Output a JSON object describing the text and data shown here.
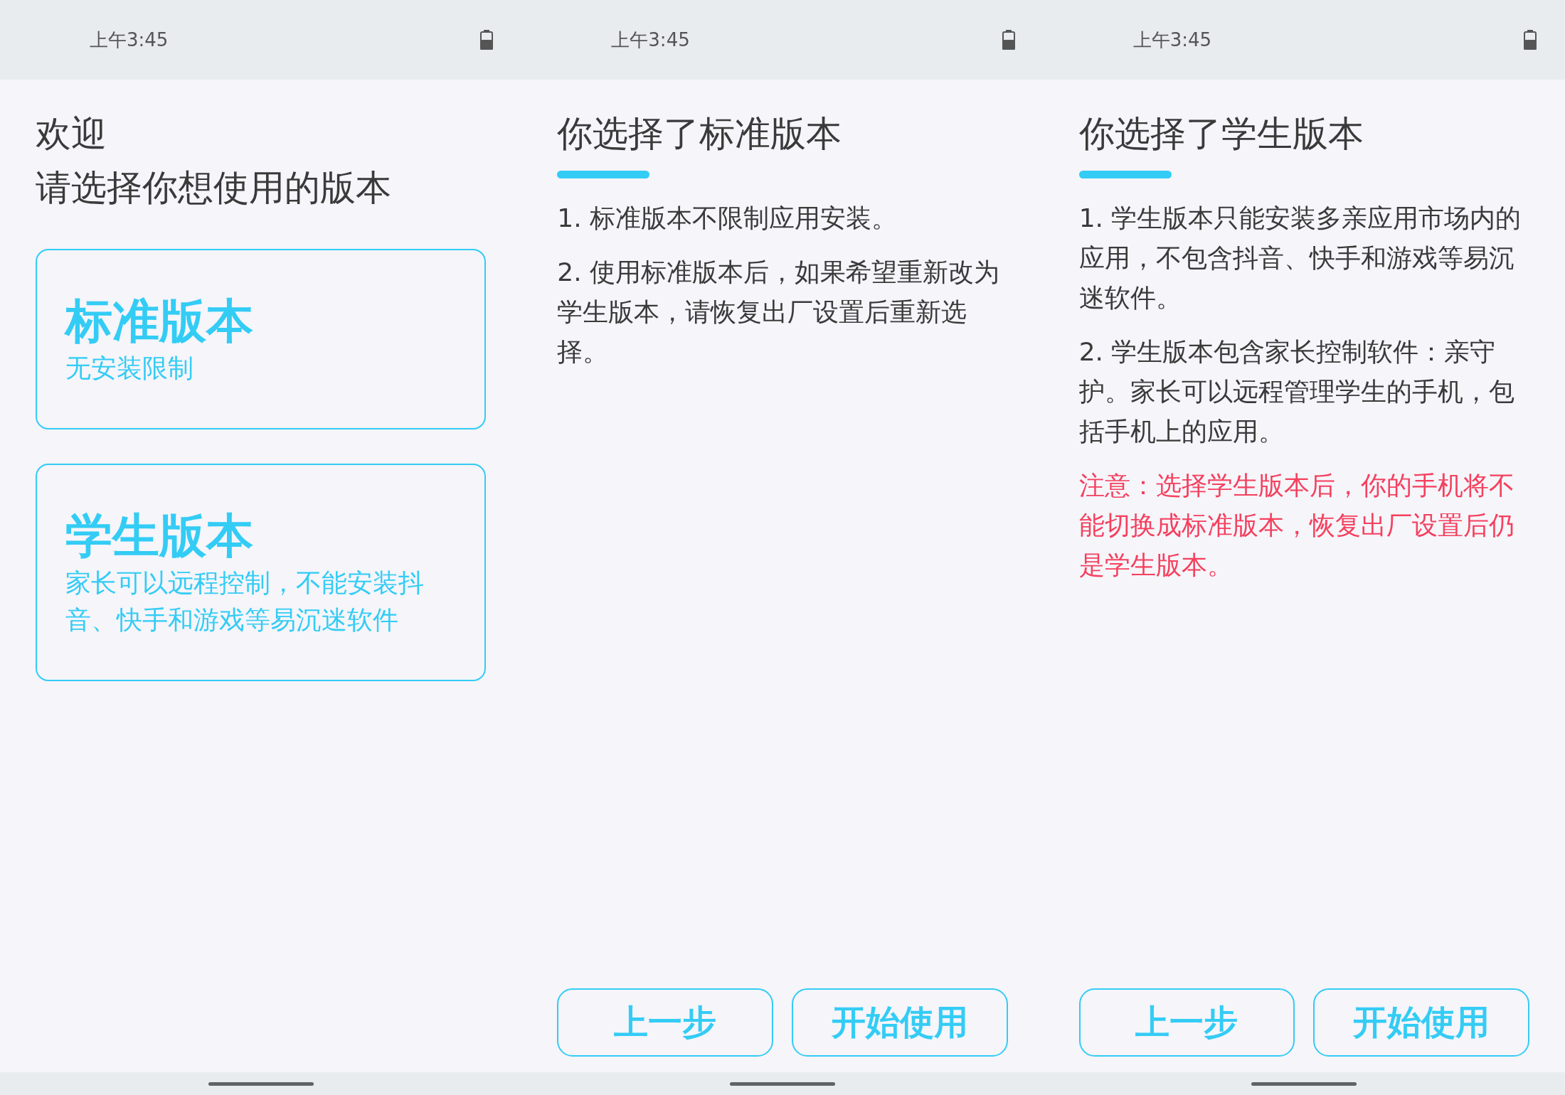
{
  "screens": [
    {
      "kind": "choose",
      "status_bar": {
        "time": "上午3:45"
      },
      "title_lines": [
        "欢迎",
        "请选择你想使用的版本"
      ],
      "options": [
        {
          "title": "标准版本",
          "subtitle": "无安装限制"
        },
        {
          "title": "学生版本",
          "subtitle": "家长可以远程控制，不能安装抖音、快手和游戏等易沉迷软件"
        }
      ]
    },
    {
      "kind": "detail",
      "status_bar": {
        "time": "上午3:45"
      },
      "title": "你选择了标准版本",
      "paragraphs": [
        {
          "kind": "normal",
          "text": "1. 标准版本不限制应用安装。"
        },
        {
          "kind": "normal",
          "text": "2. 使用标准版本后，如果希望重新改为学生版本，请恢复出厂设置后重新选择。"
        }
      ],
      "buttons": [
        "上一步",
        "开始使用"
      ]
    },
    {
      "kind": "detail",
      "status_bar": {
        "time": "上午3:45"
      },
      "title": "你选择了学生版本",
      "paragraphs": [
        {
          "kind": "normal",
          "text": "1. 学生版本只能安装多亲应用市场内的应用，不包含抖音、快手和游戏等易沉迷软件。"
        },
        {
          "kind": "normal",
          "text": "2. 学生版本包含家长控制软件：亲守护。家长可以远程管理学生的手机，包括手机上的应用。"
        },
        {
          "kind": "warning",
          "text": "注意：选择学生版本后，你的手机将不能切换成标准版本，恢复出厂设置后仍是学生版本。"
        }
      ],
      "buttons": [
        "上一步",
        "开始使用"
      ]
    }
  ]
}
